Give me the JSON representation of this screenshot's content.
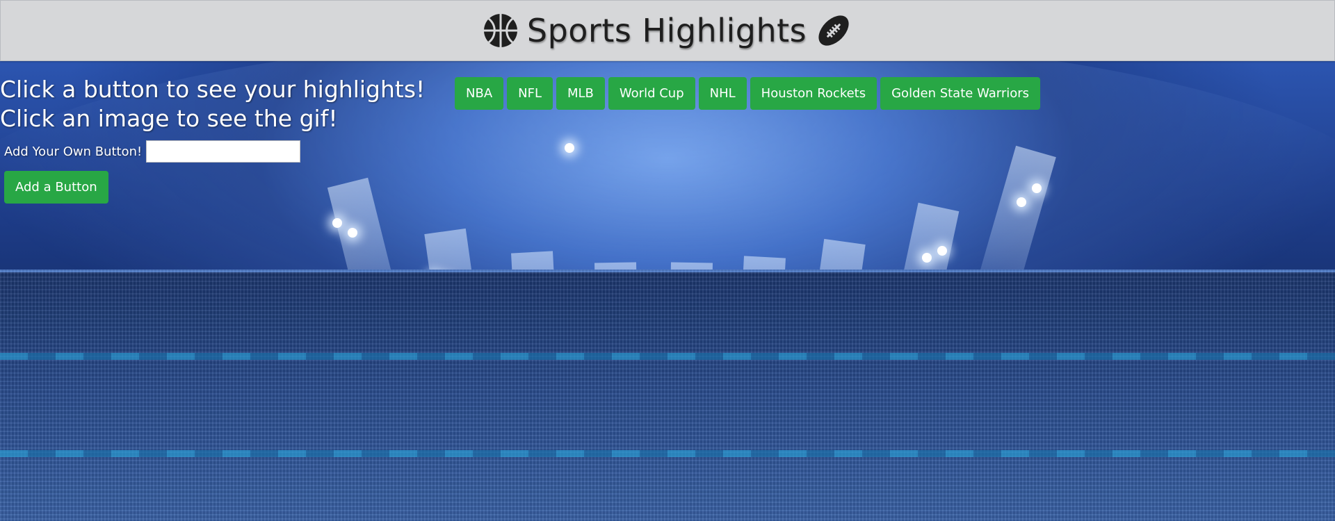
{
  "header": {
    "title": "Sports Highlights",
    "left_icon": "basketball-icon",
    "right_icon": "football-icon"
  },
  "instructions": {
    "line1": "Click a button to see your highlights!",
    "line2": "Click an image to see the gif!"
  },
  "add_button_form": {
    "label": "Add Your Own Button!",
    "input_value": "",
    "submit_label": "Add a Button"
  },
  "topics": [
    {
      "label": "NBA"
    },
    {
      "label": "NFL"
    },
    {
      "label": "MLB"
    },
    {
      "label": "World Cup"
    },
    {
      "label": "NHL"
    },
    {
      "label": "Houston Rockets"
    },
    {
      "label": "Golden State Warriors"
    }
  ],
  "colors": {
    "button_green": "#28a745",
    "header_gray": "#d6d7d9",
    "title_text": "#1f1f1f",
    "stadium_blue": "#2c55b0"
  }
}
